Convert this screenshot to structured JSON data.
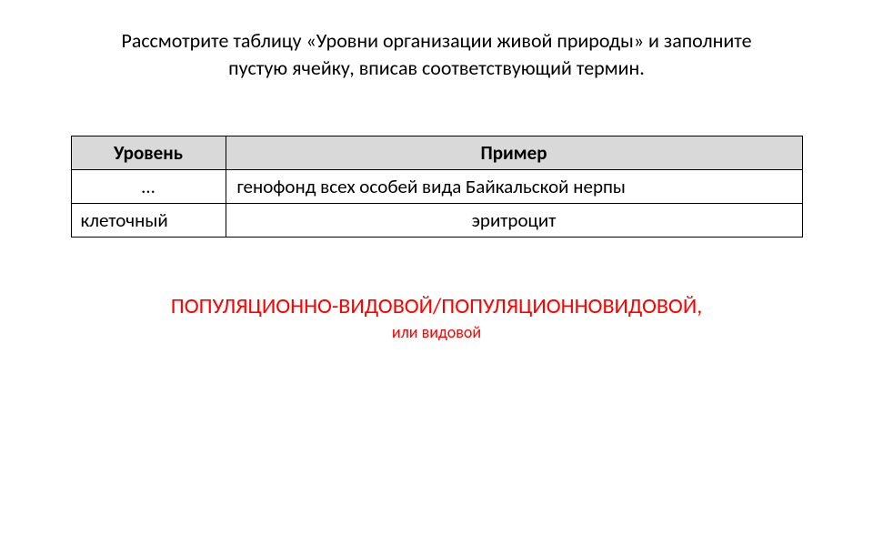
{
  "instruction": {
    "line1": "Рассмотрите таблицу «Уровни организации живой природы» и заполните",
    "line2": "пустую ячейку, вписав соответствующий термин."
  },
  "table": {
    "headers": {
      "level": "Уровень",
      "example": "Пример"
    },
    "rows": [
      {
        "level": "…",
        "example": "генофонд всех особей вида Байкальской нерпы"
      },
      {
        "level": "клеточный",
        "example": "эритроцит"
      }
    ]
  },
  "answer": {
    "line1": "ПОПУЛЯЦИОННО-ВИДОВОЙ/ПОПУЛЯЦИОННОВИДОВОЙ,",
    "line2": "или видовой"
  }
}
